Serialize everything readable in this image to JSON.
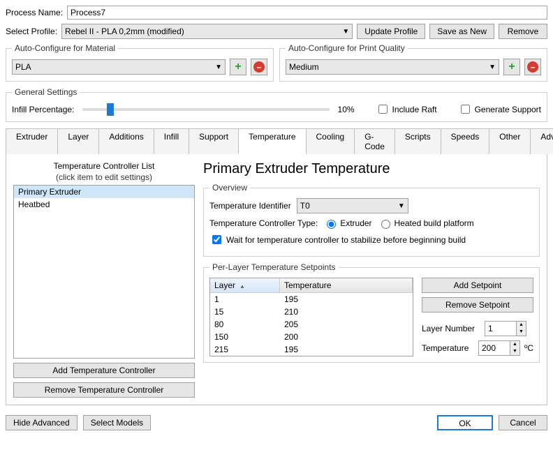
{
  "processName": {
    "label": "Process Name:",
    "value": "Process7"
  },
  "selectProfile": {
    "label": "Select Profile:",
    "value": "Rebel II - PLA 0,2mm (modified)"
  },
  "profileButtons": {
    "update": "Update Profile",
    "saveAs": "Save as New",
    "remove": "Remove"
  },
  "autoMaterial": {
    "legend": "Auto-Configure for Material",
    "value": "PLA"
  },
  "autoQuality": {
    "legend": "Auto-Configure for Print Quality",
    "value": "Medium"
  },
  "general": {
    "legend": "General Settings",
    "infillLabel": "Infill Percentage:",
    "infillValue": "10%",
    "includeRaft": "Include Raft",
    "generateSupport": "Generate Support"
  },
  "tabs": [
    "Extruder",
    "Layer",
    "Additions",
    "Infill",
    "Support",
    "Temperature",
    "Cooling",
    "G-Code",
    "Scripts",
    "Speeds",
    "Other",
    "Advanced"
  ],
  "activeTab": "Temperature",
  "controllerList": {
    "title": "Temperature Controller List",
    "sub": "(click item to edit settings)",
    "items": [
      "Primary Extruder",
      "Heatbed"
    ],
    "selected": "Primary Extruder",
    "addBtn": "Add Temperature Controller",
    "removeBtn": "Remove Temperature Controller"
  },
  "right": {
    "title": "Primary Extruder Temperature",
    "overview": {
      "legend": "Overview",
      "identLabel": "Temperature Identifier",
      "identValue": "T0",
      "typeLabel": "Temperature Controller Type:",
      "radioExtruder": "Extruder",
      "radioBed": "Heated build platform",
      "waitLabel": "Wait for temperature controller to stabilize before beginning build"
    },
    "setpoints": {
      "legend": "Per-Layer Temperature Setpoints",
      "colLayer": "Layer",
      "colTemp": "Temperature",
      "rows": [
        {
          "layer": "1",
          "temp": "195"
        },
        {
          "layer": "15",
          "temp": "210"
        },
        {
          "layer": "80",
          "temp": "205"
        },
        {
          "layer": "150",
          "temp": "200"
        },
        {
          "layer": "215",
          "temp": "195"
        }
      ],
      "addBtn": "Add Setpoint",
      "removeBtn": "Remove Setpoint",
      "layerNumLabel": "Layer Number",
      "layerNumValue": "1",
      "tempLabel": "Temperature",
      "tempValue": "200",
      "tempUnit": "ºC"
    }
  },
  "footer": {
    "hideAdv": "Hide Advanced",
    "selectModels": "Select Models",
    "ok": "OK",
    "cancel": "Cancel"
  }
}
